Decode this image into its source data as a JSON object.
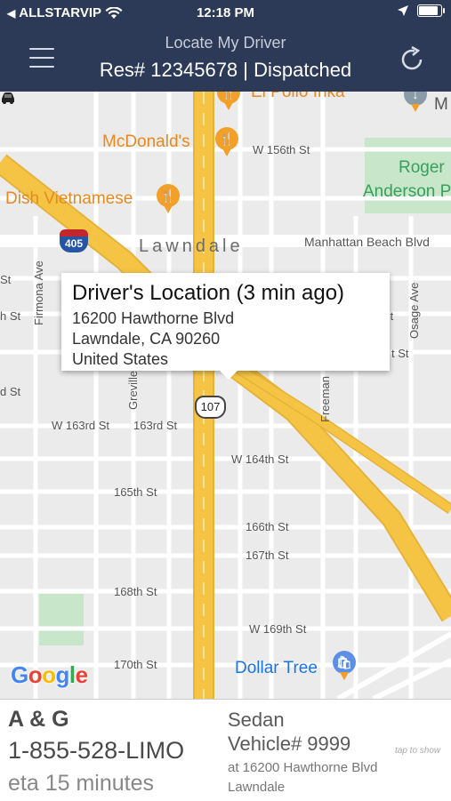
{
  "status_bar": {
    "carrier": "ALLSTARVIP",
    "time": "12:18 PM"
  },
  "header": {
    "title": "Locate My Driver",
    "subtitle": "Res# 12345678 | Dispatched"
  },
  "map": {
    "places": {
      "el_pollo": "El Pollo Inka",
      "mcdonalds": "McDonald's",
      "dish": "Dish Vietnamese",
      "roger": "Roger",
      "anderson": "Anderson P",
      "dollar_tree": "Dollar Tree",
      "m_label": "M",
      "lawndale": "Lawndale"
    },
    "streets": {
      "w156": "W 156th St",
      "manhattan": "Manhattan Beach Blvd",
      "w163": "W 163rd St",
      "s163": "163rd St",
      "w164": "W 164th St",
      "s165": "165th St",
      "s166": "166th St",
      "s167": "167th St",
      "s168": "168th St",
      "w169": "W 169th St",
      "s170": "170th St",
      "firmona": "Firmona Ave",
      "grevillea": "Grevillea",
      "freeman": "Freeman",
      "osage": "Osage Ave",
      "st1": "St",
      "st2": "h St",
      "st3": "d St",
      "st4": "t St",
      "st5": "St"
    },
    "shields": {
      "interstate": "405",
      "state": "107"
    },
    "attribution": [
      "G",
      "o",
      "o",
      "g",
      "l",
      "e"
    ]
  },
  "callout": {
    "title": "Driver's Location (3 min ago)",
    "line1": "16200 Hawthorne Blvd",
    "line2": "Lawndale, CA  90260",
    "line3": "United States"
  },
  "bottom": {
    "company": "A & G",
    "phone": "1-855-528-LIMO",
    "eta": "eta 15 minutes",
    "vehicle_type": "Sedan",
    "vehicle_number": "Vehicle# 9999",
    "vehicle_location": "at 16200 Hawthorne Blvd Lawndale",
    "tap_hint": "tap to show"
  },
  "colors": {
    "header_bg": "#2c3a57",
    "highway": "#f6c445",
    "poi": "#e8891f",
    "park": "#c8e6c9"
  }
}
